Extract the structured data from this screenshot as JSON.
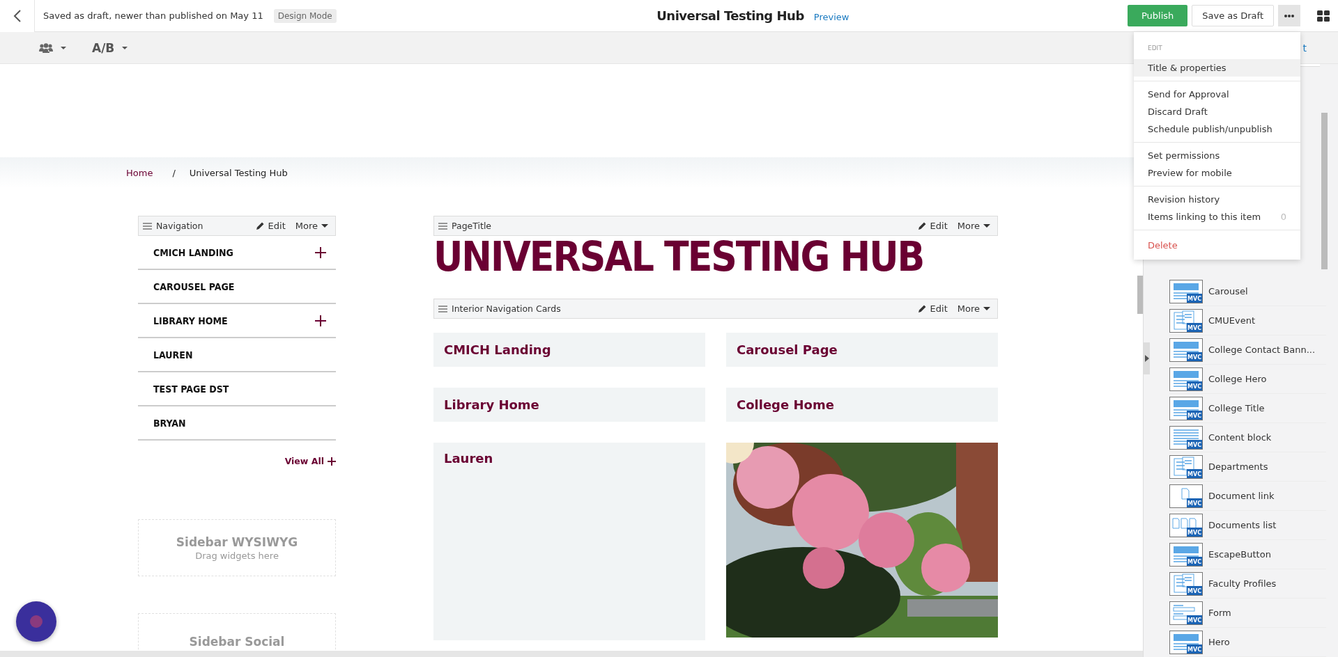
{
  "topbar": {
    "status": "Saved as draft, newer than published on May 11",
    "mode_badge": "Design Mode",
    "title": "Universal Testing Hub",
    "preview_link": "Preview",
    "publish_button": "Publish",
    "save_button": "Save as Draft"
  },
  "toolbar": {
    "ab_label": "A/B",
    "right_link": "t"
  },
  "menu": {
    "header": "EDIT",
    "sections": [
      [
        {
          "label": "Title & properties",
          "selected": true,
          "kind": "normal"
        }
      ],
      [
        {
          "label": "Send for Approval",
          "selected": false,
          "kind": "normal"
        },
        {
          "label": "Discard Draft",
          "selected": false,
          "kind": "normal"
        },
        {
          "label": "Schedule publish/unpublish",
          "selected": false,
          "kind": "normal"
        }
      ],
      [
        {
          "label": "Set permissions",
          "selected": false,
          "kind": "normal"
        },
        {
          "label": "Preview for mobile",
          "selected": false,
          "kind": "normal"
        }
      ],
      [
        {
          "label": "Revision history",
          "selected": false,
          "kind": "normal"
        },
        {
          "label": "Items linking to this item",
          "count": "0",
          "selected": false,
          "kind": "normal"
        }
      ],
      [
        {
          "label": "Delete",
          "selected": false,
          "kind": "danger"
        }
      ]
    ]
  },
  "breadcrumb": {
    "home": "Home",
    "separator": "/",
    "current": "Universal Testing Hub"
  },
  "navigation_widget": {
    "label": "Navigation",
    "edit": "Edit",
    "more": "More",
    "items": [
      {
        "label": "CMICH LANDING",
        "expandable": true
      },
      {
        "label": "CAROUSEL PAGE",
        "expandable": false
      },
      {
        "label": "LIBRARY HOME",
        "expandable": true
      },
      {
        "label": "LAUREN",
        "expandable": false
      },
      {
        "label": "TEST PAGE DST",
        "expandable": false
      },
      {
        "label": "BRYAN",
        "expandable": false
      }
    ],
    "view_all": "View All"
  },
  "drop_zones": [
    {
      "title": "Sidebar WYSIWYG",
      "hint": "Drag widgets here"
    },
    {
      "title": "Sidebar Social"
    }
  ],
  "page_title_widget": {
    "label": "PageTitle",
    "edit": "Edit",
    "more": "More",
    "heading": "UNIVERSAL TESTING HUB"
  },
  "cards_widget": {
    "label": "Interior Navigation Cards",
    "edit": "Edit",
    "more": "More",
    "cards": [
      {
        "kind": "link",
        "title": "CMICH Landing"
      },
      {
        "kind": "link",
        "title": "Carousel Page"
      },
      {
        "kind": "link",
        "title": "Library Home"
      },
      {
        "kind": "link",
        "title": "College Home"
      },
      {
        "kind": "link",
        "title": "Lauren"
      },
      {
        "kind": "picture"
      }
    ]
  },
  "widgets_panel": {
    "items": [
      {
        "name": "Carousel",
        "badge": "MVC",
        "kind": "banner"
      },
      {
        "name": "CMUEvent",
        "badge": "MVC",
        "kind": "columns"
      },
      {
        "name": "College Contact Bann...",
        "badge": "MVC",
        "kind": "banner"
      },
      {
        "name": "College Hero",
        "badge": "MVC",
        "kind": "banner"
      },
      {
        "name": "College Title",
        "badge": "MVC",
        "kind": "banner"
      },
      {
        "name": "Content block",
        "badge": "MVC",
        "kind": "text"
      },
      {
        "name": "Departments",
        "badge": "MVC",
        "kind": "columns"
      },
      {
        "name": "Document link",
        "badge": "MVC",
        "kind": "doc"
      },
      {
        "name": "Documents list",
        "badge": "MVC",
        "kind": "docs"
      },
      {
        "name": "EscapeButton",
        "badge": "MVC",
        "kind": "banner"
      },
      {
        "name": "Faculty Profiles",
        "badge": "MVC",
        "kind": "columns"
      },
      {
        "name": "Form",
        "badge": "MVC",
        "kind": "form"
      },
      {
        "name": "Hero",
        "badge": "MVC",
        "kind": "banner"
      }
    ]
  }
}
